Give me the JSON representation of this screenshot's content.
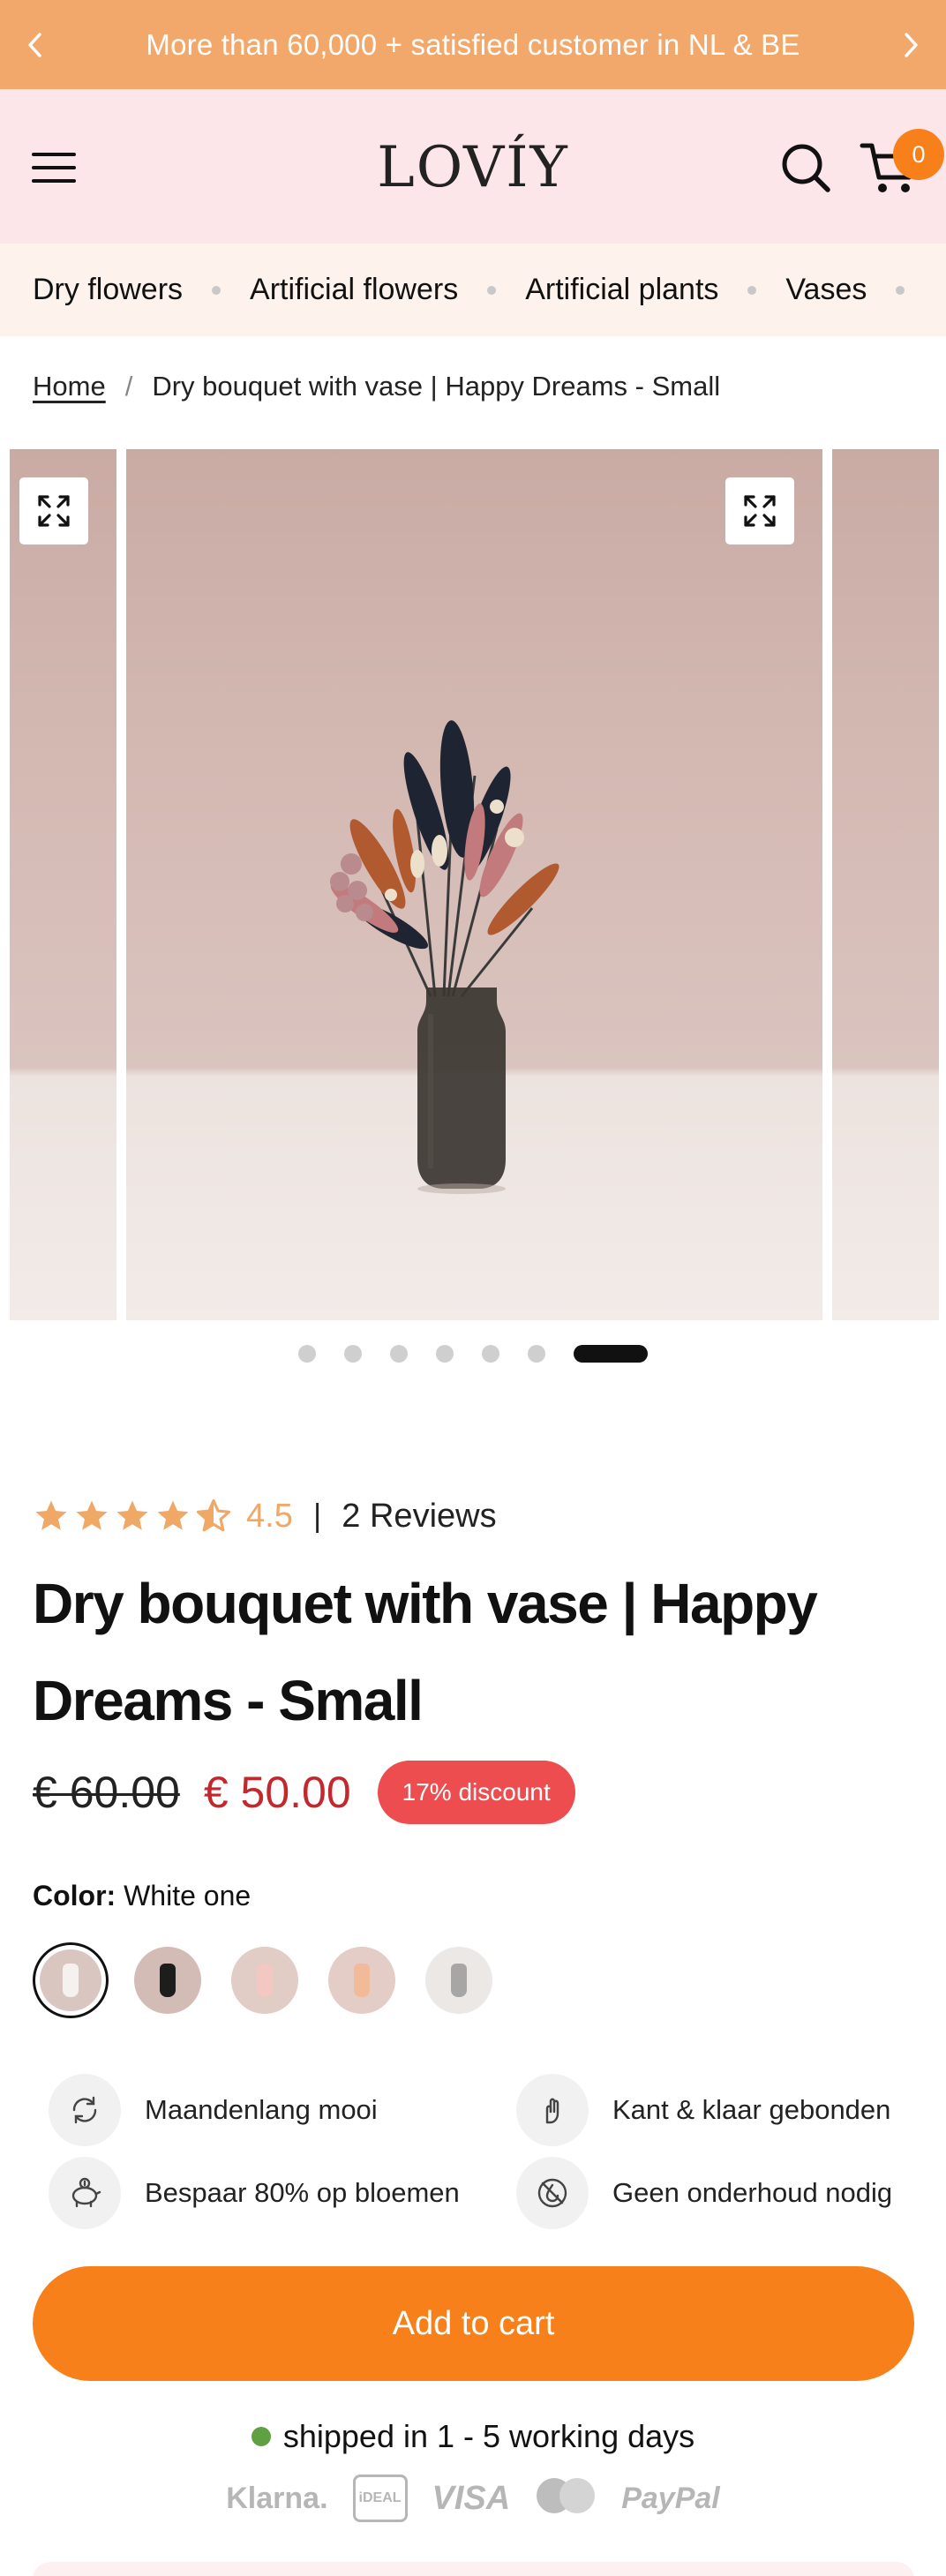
{
  "announcement": {
    "text": "More than 60,000 + satisfied customer in NL & BE",
    "prev_icon": "chevron-left-icon",
    "next_icon": "chevron-right-icon"
  },
  "header": {
    "logo": "LOVÍY",
    "cart_count": "0"
  },
  "categories": [
    "Dry flowers",
    "Artificial flowers",
    "Artificial plants",
    "Vases"
  ],
  "breadcrumb": {
    "home": "Home",
    "current": "Dry bouquet with vase | Happy Dreams - Small"
  },
  "gallery": {
    "slide_count": 7,
    "active_index": 6
  },
  "product": {
    "rating": 4.5,
    "rating_text": "4.5",
    "separator": "|",
    "reviews": "2 Reviews",
    "title": "Dry bouquet with vase | Happy Dreams - Small",
    "old_price": "€ 60.00",
    "new_price": "€ 50.00",
    "discount": "17% discount",
    "color_label": "Color:",
    "color_value": "White one",
    "swatches": [
      {
        "name": "White one",
        "bg": "#d9c6c1",
        "vase": "#f4f1ee"
      },
      {
        "name": "Black",
        "bg": "#d3bcb6",
        "vase": "#1d1d1d"
      },
      {
        "name": "Pink",
        "bg": "#e1ccc6",
        "vase": "#f3c8c2"
      },
      {
        "name": "Peach",
        "bg": "#e3cdc6",
        "vase": "#f1bb99"
      },
      {
        "name": "Grey",
        "bg": "#ece8e6",
        "vase": "#a8a6a4"
      }
    ]
  },
  "features": [
    {
      "label": "Maandenlang mooi",
      "icon": "recycle-icon"
    },
    {
      "label": "Kant & klaar gebonden",
      "icon": "hand-icon"
    },
    {
      "label": "Bespaar 80% op bloemen",
      "icon": "piggy-bank-icon"
    },
    {
      "label": "Geen onderhoud nodig",
      "icon": "no-water-icon"
    }
  ],
  "cta": {
    "add_to_cart": "Add to cart"
  },
  "shipping": {
    "prefix": "shipped in",
    "days": "1 - 5 working days"
  },
  "payments": {
    "klarna": "Klarna.",
    "ideal": "iDEAL",
    "visa": "VISA",
    "mastercard": "mastercard",
    "paypal": "PayPal"
  },
  "colors": {
    "announcement_bg": "#f2a86b",
    "header_bg": "#fde6ea",
    "accent": "#f7801a",
    "sale_red": "#c3282d",
    "discount_bg": "#ee4d4f",
    "star": "#f0a867"
  }
}
